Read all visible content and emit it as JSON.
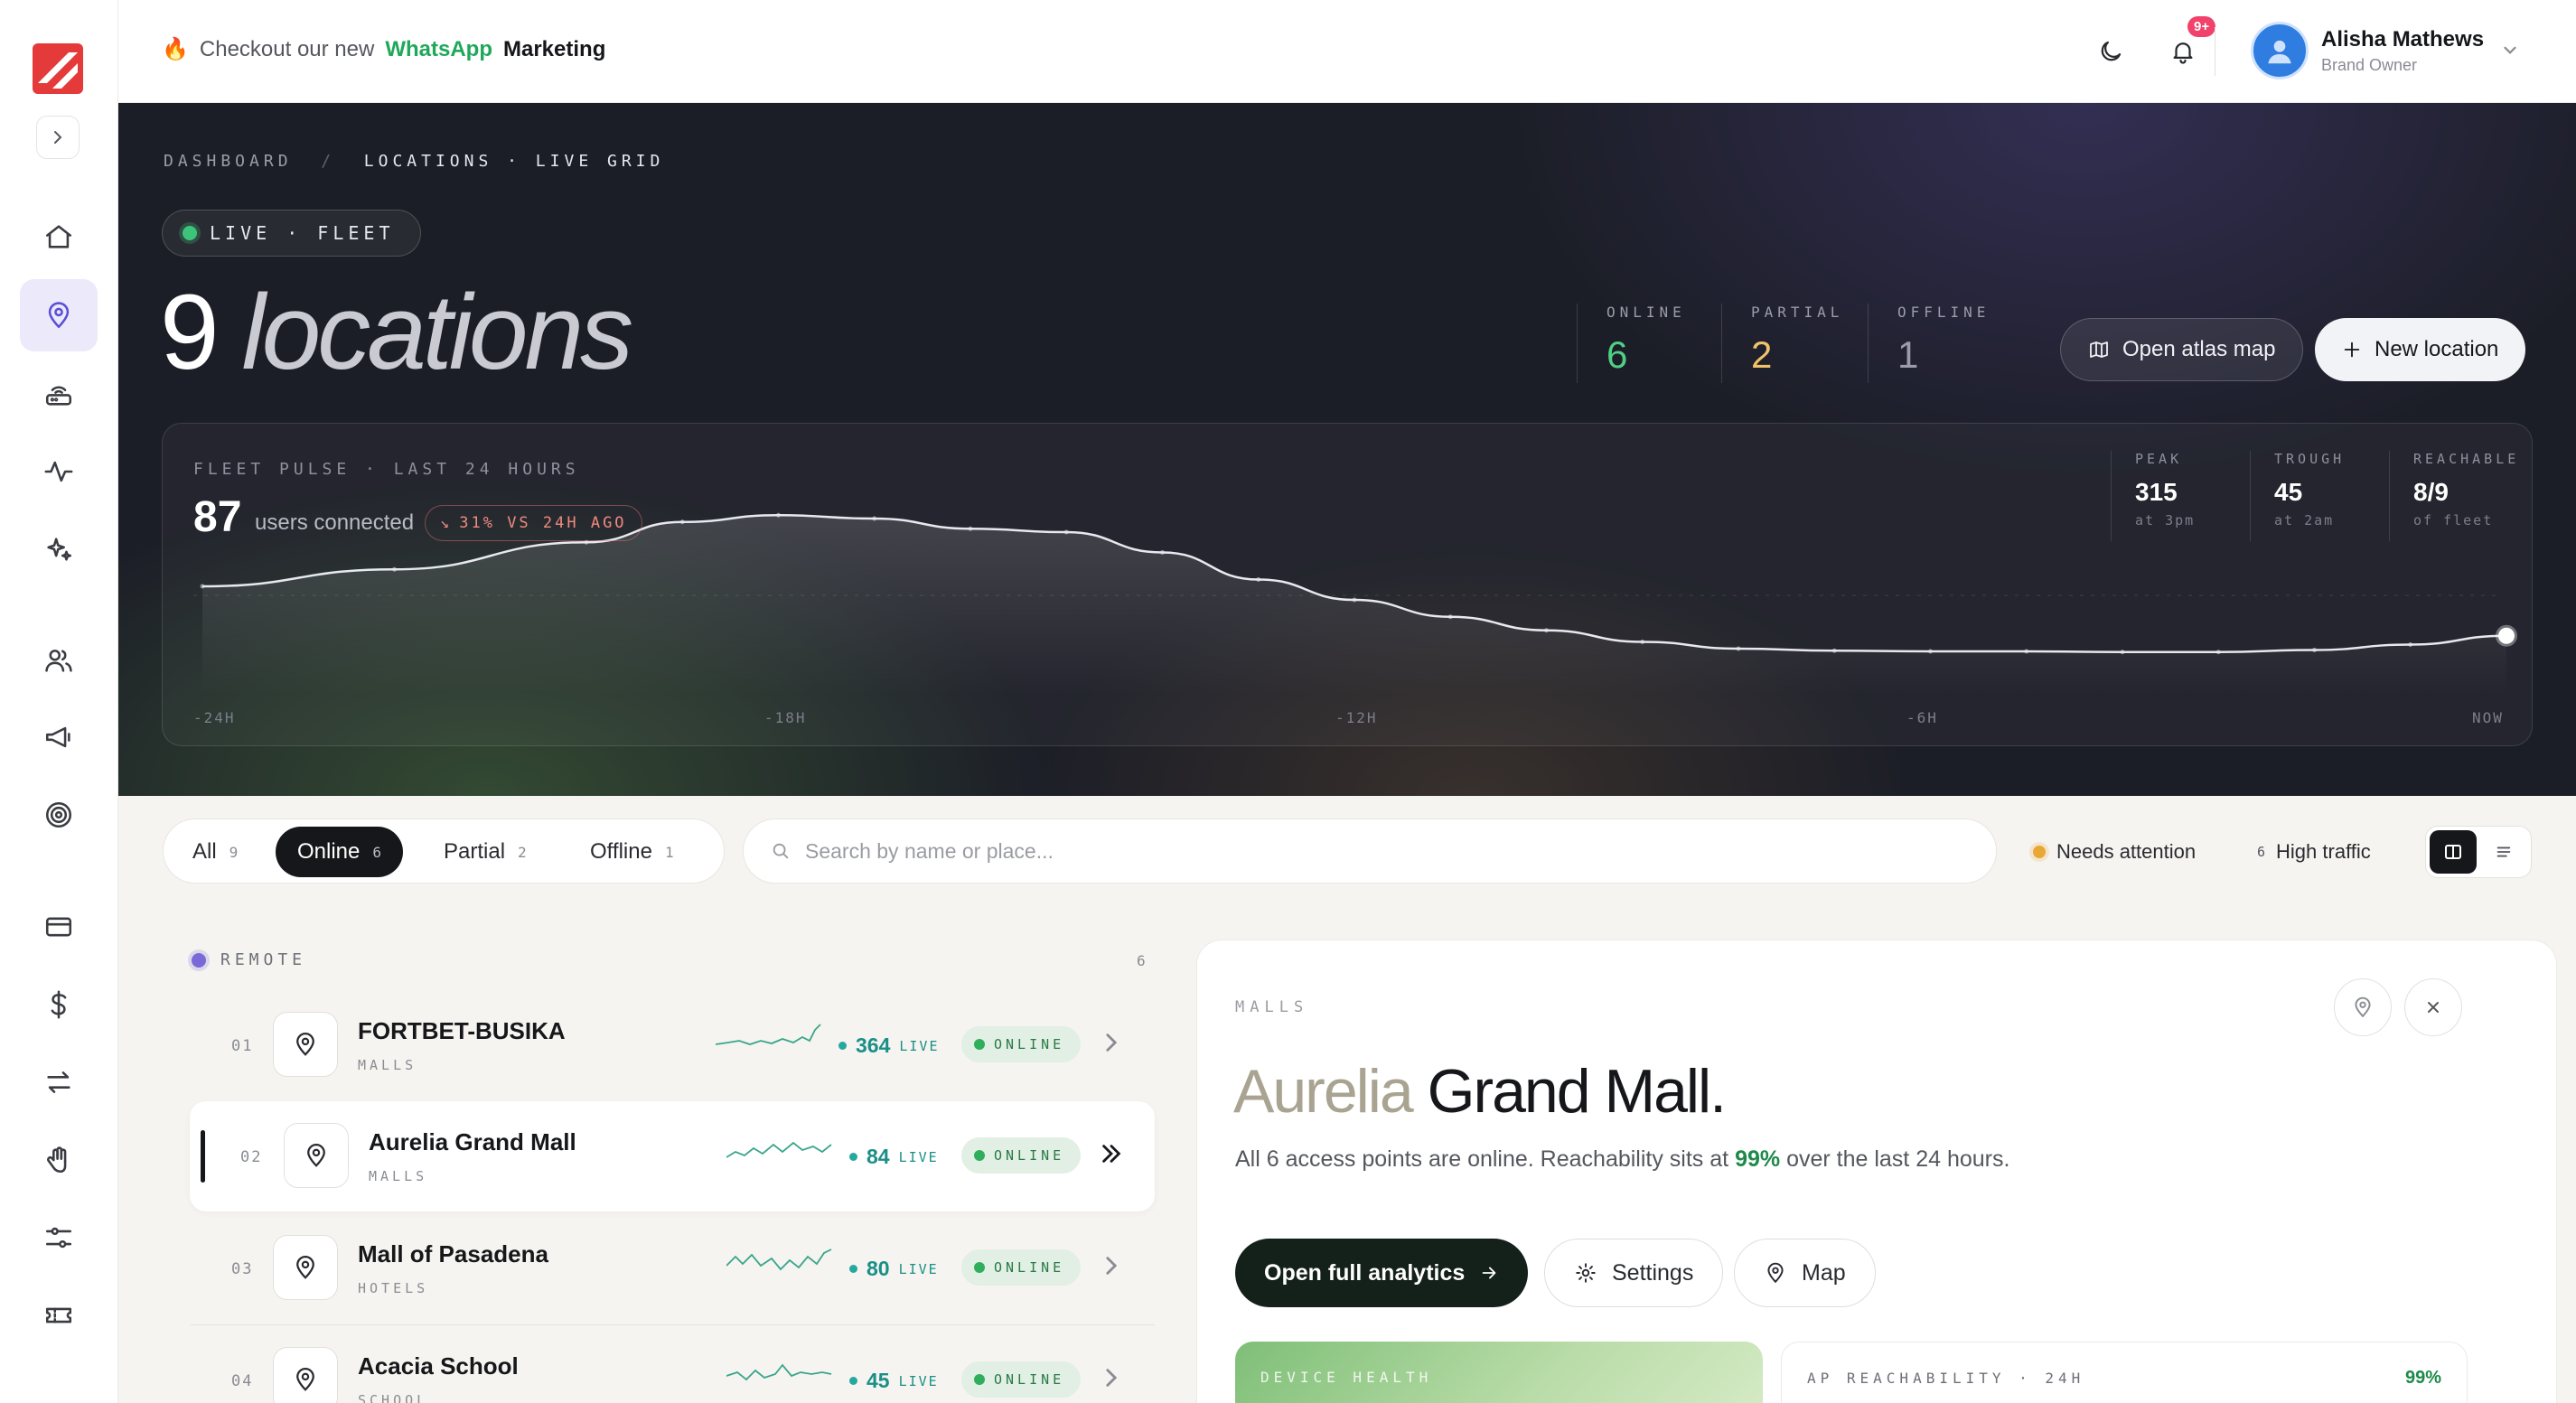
{
  "topbar": {
    "promo_prefix": "Checkout our new",
    "promo_brand": "WhatsApp",
    "promo_suffix": "Marketing",
    "notif_badge": "9+",
    "user_name": "Alisha Mathews",
    "user_role": "Brand Owner"
  },
  "hero": {
    "breadcrumb": {
      "root": "DASHBOARD",
      "sep": "/",
      "current": "LOCATIONS · LIVE GRID"
    },
    "live_pill": "LIVE · FLEET",
    "count": "9",
    "count_word": "locations",
    "stats": [
      {
        "label": "ONLINE",
        "value": "6",
        "color": "#4fcf86"
      },
      {
        "label": "PARTIAL",
        "value": "2",
        "color": "#f0c36a"
      },
      {
        "label": "OFFLINE",
        "value": "1",
        "color": "#9a9caa"
      }
    ],
    "btn_atlas": "Open atlas map",
    "btn_new": "New location"
  },
  "pulse": {
    "label": "FLEET PULSE · LAST 24 HOURS",
    "value": "87",
    "unit": "users connected",
    "delta": "31% VS 24H AGO",
    "stats": [
      {
        "label": "PEAK",
        "value": "315",
        "sub": "at 3pm"
      },
      {
        "label": "TROUGH",
        "value": "45",
        "sub": "at 2am"
      },
      {
        "label": "REACHABLE",
        "value": "8/9",
        "sub": "of fleet"
      }
    ],
    "axis": [
      "-24H",
      "-18H",
      "-12H",
      "-6H",
      "NOW"
    ]
  },
  "chart_data": {
    "type": "area",
    "title": "FLEET PULSE · LAST 24 HOURS",
    "x": [
      -24,
      -22,
      -20,
      -19,
      -18,
      -17,
      -16,
      -15,
      -14,
      -13,
      -12,
      -11,
      -10,
      -9,
      -8,
      -7,
      -6,
      -5,
      -4,
      -3,
      -2,
      -1,
      0
    ],
    "series": [
      {
        "values": [
          160,
          185,
          225,
          255,
          265,
          260,
          245,
          240,
          210,
          170,
          140,
          115,
          95,
          78,
          68,
          65,
          64,
          64,
          63,
          63,
          66,
          74,
          87
        ]
      }
    ],
    "xlabel": "",
    "ylabel": "",
    "ylim": [
      0,
      320
    ],
    "grid": false
  },
  "filters": {
    "segments": [
      {
        "label": "All",
        "count": "9"
      },
      {
        "label": "Online",
        "count": "6"
      },
      {
        "label": "Partial",
        "count": "2"
      },
      {
        "label": "Offline",
        "count": "1"
      }
    ],
    "search_placeholder": "Search by name or place...",
    "chip_attention": "Needs attention",
    "chip_traffic_count": "6",
    "chip_traffic": "High traffic"
  },
  "list": {
    "group": "REMOTE",
    "group_count": "6",
    "live_unit": "LIVE",
    "rows": [
      {
        "idx": "01",
        "name": "FORTBET-BUSIKA",
        "cat": "MALLS",
        "live": "364",
        "status": "ONLINE"
      },
      {
        "idx": "02",
        "name": "Aurelia Grand Mall",
        "cat": "MALLS",
        "live": "84",
        "status": "ONLINE"
      },
      {
        "idx": "03",
        "name": "Mall of Pasadena",
        "cat": "HOTELS",
        "live": "80",
        "status": "ONLINE"
      },
      {
        "idx": "04",
        "name": "Acacia School",
        "cat": "SCHOOL",
        "live": "45",
        "status": "ONLINE"
      }
    ]
  },
  "detail": {
    "cat": "MALLS",
    "title_a": "Aurelia",
    "title_b": "Grand Mall.",
    "desc_pre": "All 6 access points are online. Reachability sits at",
    "desc_pct": "99%",
    "desc_post": "over the last 24 hours.",
    "btn_analytics": "Open full analytics",
    "btn_settings": "Settings",
    "btn_map": "Map",
    "card_health": "DEVICE HEALTH",
    "card_reach": "AP REACHABILITY · 24H",
    "card_reach_pct": "99%"
  }
}
